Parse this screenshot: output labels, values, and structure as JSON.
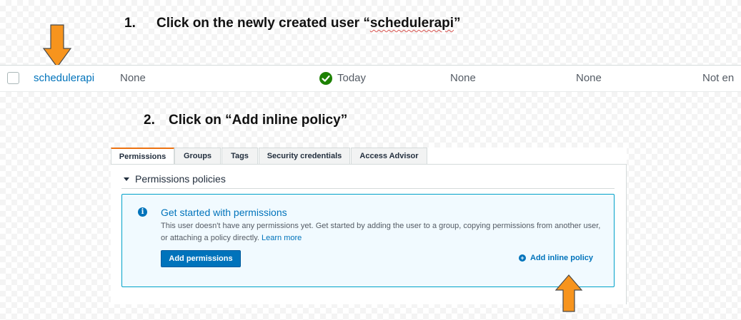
{
  "steps": {
    "step1_number": "1.",
    "step1_text_prefix": "Click on the newly created user “",
    "step1_text_user": "schedulerapi",
    "step1_text_suffix": "”",
    "step2_number": "2.",
    "step2_text": "Click on “Add inline policy”"
  },
  "user_row": {
    "username": "schedulerapi",
    "groups": "None",
    "last_activity": "Today",
    "mfa": "None",
    "password_age": "None",
    "console_access": "Not en"
  },
  "tabs": [
    {
      "label": "Permissions",
      "active": true
    },
    {
      "label": "Groups",
      "active": false
    },
    {
      "label": "Tags",
      "active": false
    },
    {
      "label": "Security credentials",
      "active": false
    },
    {
      "label": "Access Advisor",
      "active": false
    }
  ],
  "permissions": {
    "section_title": "Permissions policies",
    "info_icon": "info-circle-icon",
    "info_title": "Get started with permissions",
    "info_text": "This user doesn't have any permissions yet. Get started by adding the user to a group, copying permissions from another user, or attaching a policy directly. ",
    "learn_more": "Learn more",
    "add_permissions_button": "Add permissions",
    "add_inline_policy": "Add inline policy"
  },
  "colors": {
    "arrow_fill": "#f7941d",
    "link_blue": "#0073bb",
    "success_green": "#1d8102",
    "active_tab_accent": "#ec7211"
  }
}
